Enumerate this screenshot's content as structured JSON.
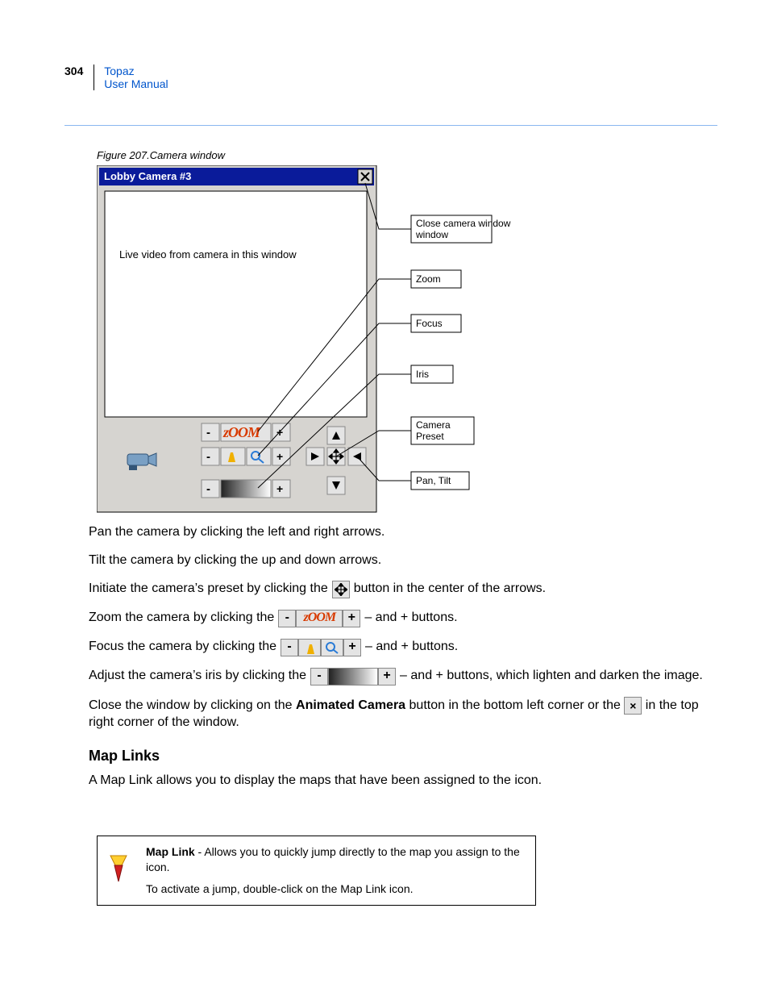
{
  "header": {
    "page_number": "304",
    "product": "Topaz",
    "doc": "User Manual"
  },
  "figure": {
    "caption": "Figure 207.Camera window",
    "window_title": "Lobby Camera #3",
    "video_placeholder": "Live video from camera in this window",
    "callouts": {
      "close": "Close camera window",
      "zoom": "Zoom",
      "focus": "Focus",
      "iris": "Iris",
      "preset": "Camera Preset",
      "pantilt": "Pan, Tilt"
    },
    "zoom_label": "zOOM"
  },
  "paragraphs": {
    "pan": "Pan the camera by clicking the left and right arrows.",
    "tilt": "Tilt the camera by clicking the up and down arrows.",
    "initiate_a": "Initiate the camera’s preset by clicking the",
    "initiate_b": "button in the center of the arrows.",
    "zoom_a": "Zoom the camera by clicking the",
    "zoom_b": "– and + buttons.",
    "focus_a": "Focus the camera by clicking the",
    "focus_b": "– and + buttons.",
    "iris_a": "Adjust the camera’s iris by clicking the",
    "iris_b": "– and + buttons, which lighten and darken the image.",
    "close_a": "Close the window by clicking on the ",
    "close_bold": "Animated Camera",
    "close_b": " button in the bottom left corner or the ",
    "close_c": " in the top right corner of the window."
  },
  "section_heading": "Map Links",
  "section_intro": "A Map Link allows you to display the maps that have been assigned to the icon.",
  "maplink_box": {
    "line1_bold": "Map Link",
    "line1_rest": " - Allows you to quickly jump directly to the map you assign to the icon.",
    "line2": "To activate a jump, double-click on the Map Link icon."
  },
  "glyphs": {
    "minus": "-",
    "plus": "+",
    "x": "×"
  }
}
